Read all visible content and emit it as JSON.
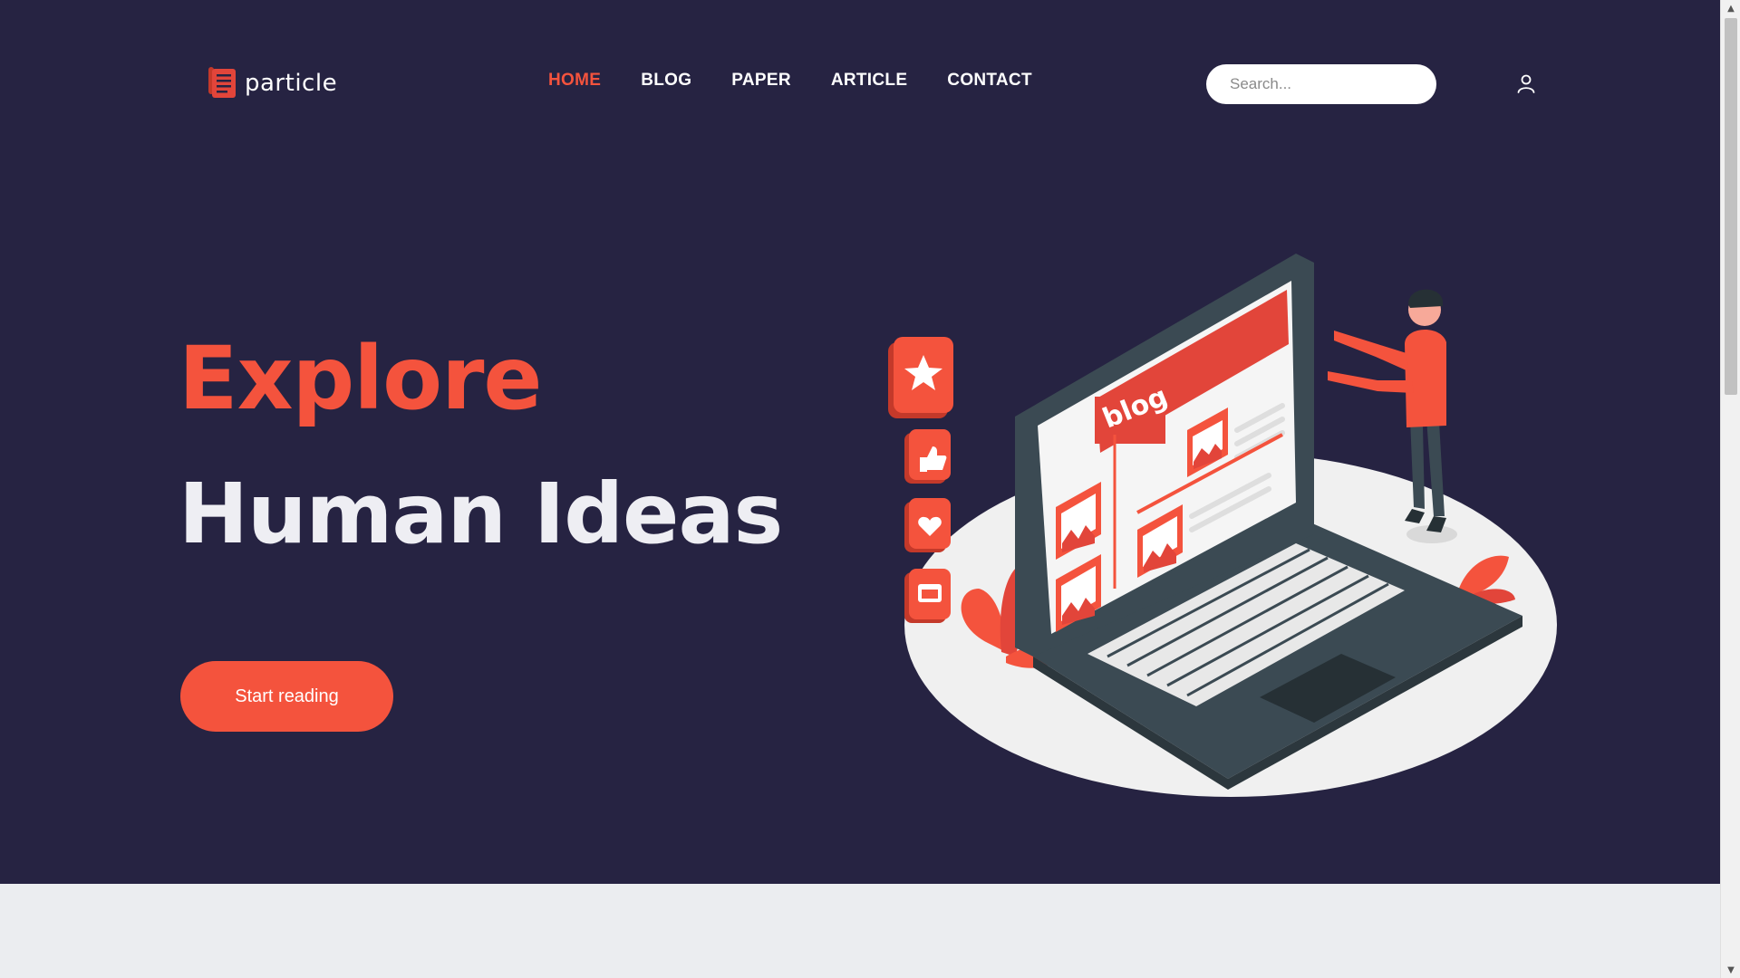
{
  "brand": {
    "name": "particle"
  },
  "nav": {
    "items": [
      {
        "label": "HOME",
        "active": true
      },
      {
        "label": "BLOG",
        "active": false
      },
      {
        "label": "PAPER",
        "active": false
      },
      {
        "label": "ARTICLE",
        "active": false
      },
      {
        "label": "CONTACT",
        "active": false
      }
    ]
  },
  "search": {
    "placeholder": "Search..."
  },
  "hero": {
    "line1": "Explore",
    "line2": "Human Ideas",
    "cta_label": "Start reading",
    "illustration_screen_text": "blog"
  },
  "colors": {
    "background": "#262342",
    "accent": "#f4533d",
    "section_bg": "#ebedf0"
  },
  "icons": {
    "search": "search-icon",
    "user": "user-icon",
    "scroll_up": "▲",
    "scroll_down": "▼"
  }
}
